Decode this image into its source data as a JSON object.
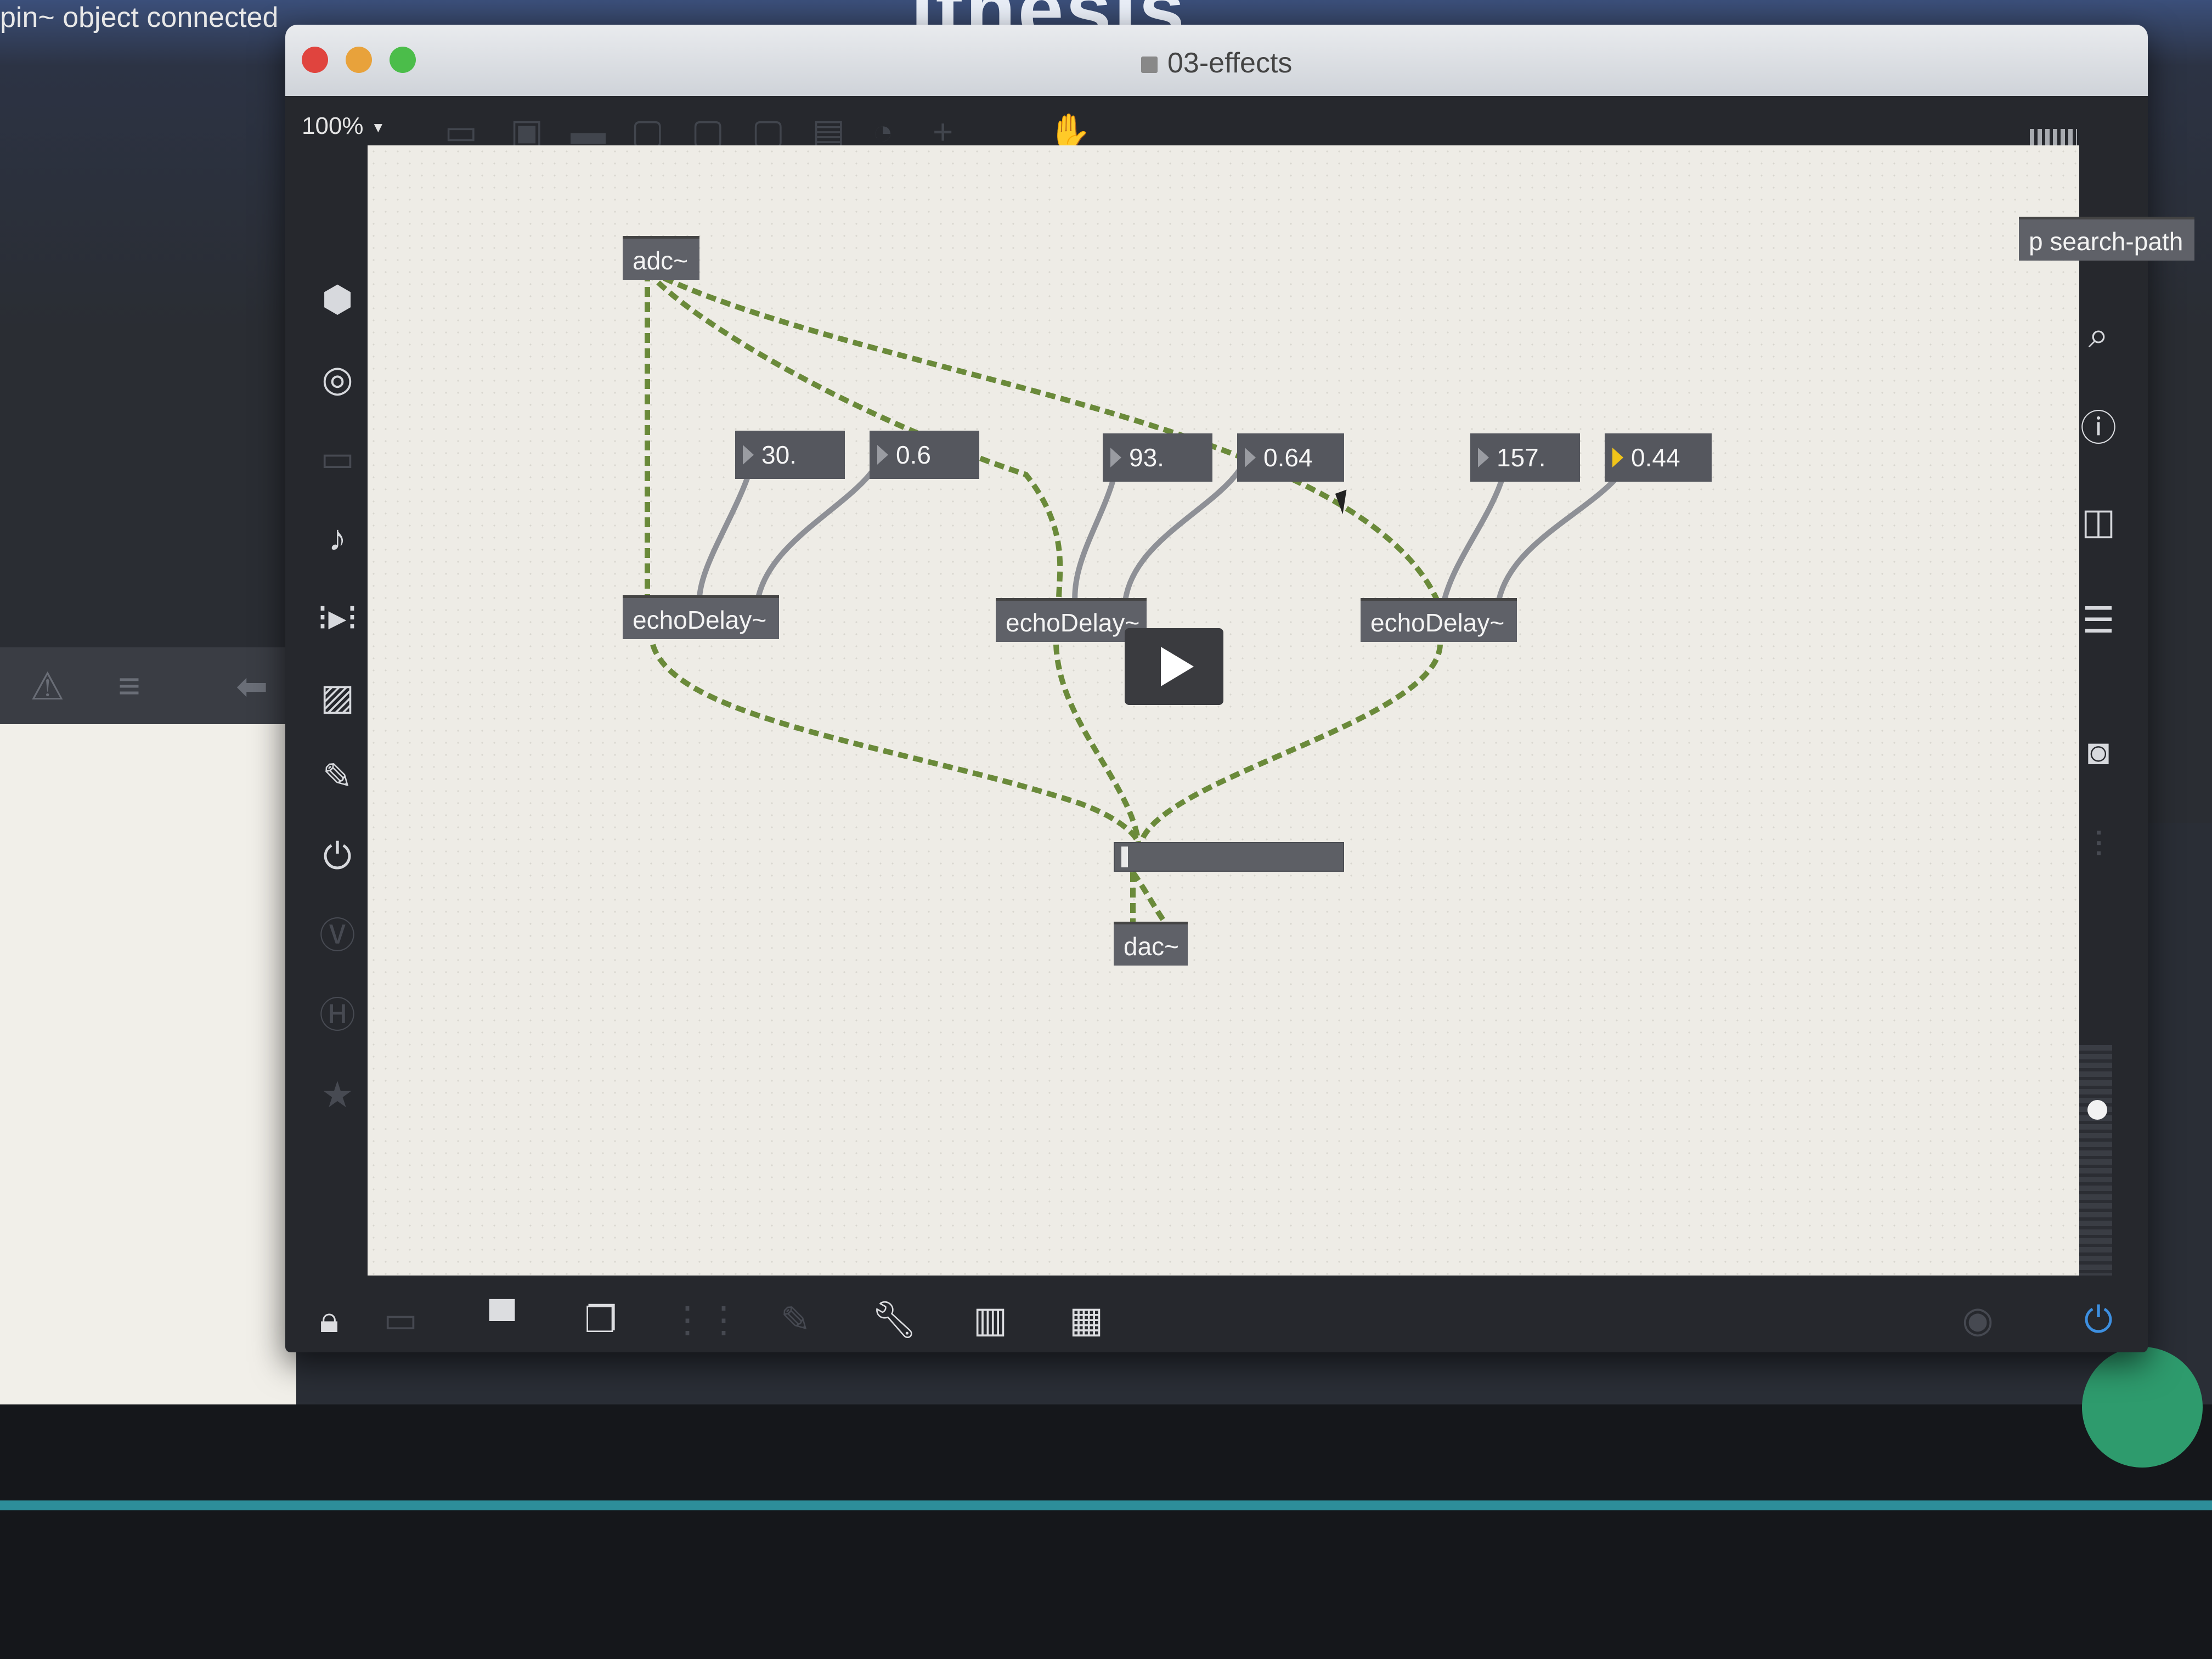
{
  "background": {
    "status_text": "pin~ object connected",
    "big_title_fragment": "ithesis"
  },
  "window": {
    "title": "03-effects",
    "zoom": "100%",
    "traffic_lights": {
      "close": "#e0443e",
      "minimize": "#e8a23b",
      "maximize": "#4bbd4a"
    }
  },
  "patch": {
    "objects": {
      "adc": "adc~",
      "echo1": "echoDelay~",
      "echo2": "echoDelay~",
      "echo3": "echoDelay~",
      "dac": "dac~",
      "search_path": "p search-path"
    },
    "number_boxes": {
      "n1": "30.",
      "n2": "0.6",
      "n3": "93.",
      "n4": "0.64",
      "n5": "157.",
      "n6": "0.44"
    },
    "signal_wire_color": "#6a8a3a",
    "control_wire_color": "#8e9096",
    "gain_level": 0.02
  },
  "left_sidebar_icons": [
    "package-icon",
    "target-icon",
    "film-icon",
    "music-note-icon",
    "sequence-icon",
    "image-icon",
    "paperclip-icon",
    "plug-icon",
    "v-icon",
    "h-icon",
    "star-icon"
  ],
  "right_sidebar_icons": [
    "search-icon",
    "info-icon",
    "columns-icon",
    "list-icon",
    "camera-icon",
    "mixer-icon"
  ],
  "bottom_toolbar_icons": [
    "lock-icon",
    "edit-icon",
    "presentation-icon",
    "windows-icon",
    "grid-icon",
    "pencil-icon",
    "wrench-icon",
    "piano-icon",
    "keyboard-icon",
    "play-icon",
    "power-icon"
  ]
}
